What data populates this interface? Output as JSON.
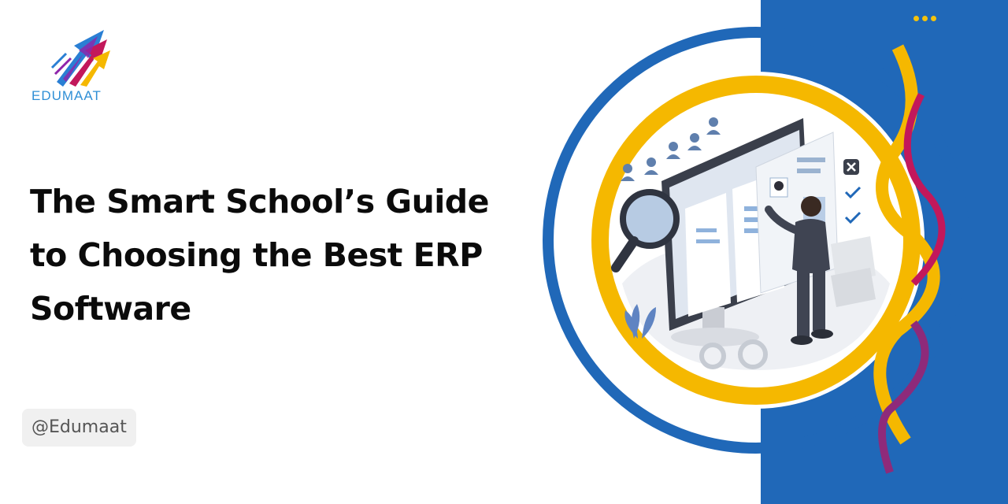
{
  "brand": {
    "name": "EDUMAAT",
    "colors": {
      "blue": "#2068b8",
      "yellow": "#f5b800",
      "magenta": "#c2185b",
      "purple": "#8e24aa",
      "text": "#0b0b0b"
    }
  },
  "headline": {
    "line1": "The Smart School’s Guide",
    "line2": "to Choosing the Best ERP",
    "line3": "Software"
  },
  "handle": "@Edumaat",
  "decor": {
    "menu_icon": "more-dots-icon",
    "illustration": "erp-dashboard-illustration"
  }
}
